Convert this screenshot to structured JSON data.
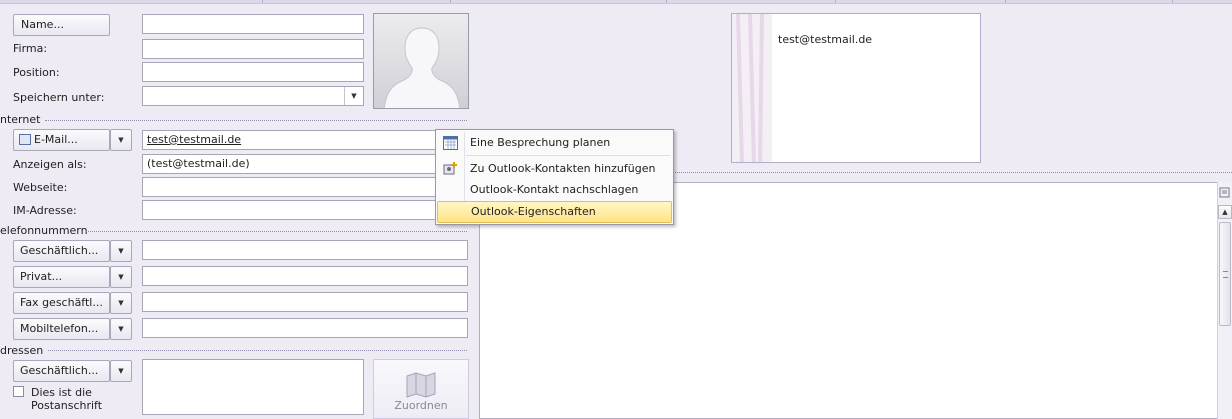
{
  "name_section": {
    "name_button": "Name...",
    "company_label": "Firma:",
    "position_label": "Position:",
    "save_as_label": "Speichern unter:"
  },
  "internet": {
    "section_title": "nternet",
    "email_button": "E-Mail...",
    "email_value": "test@testmail.de",
    "display_as_label": "Anzeigen als:",
    "display_as_value": "(test@testmail.de)",
    "webpage_label": "Webseite:",
    "im_label": "IM-Adresse:"
  },
  "phones": {
    "section_title": "elefonnummern",
    "items": [
      {
        "label": "Geschäftlich..."
      },
      {
        "label": "Privat..."
      },
      {
        "label": "Fax geschäftl..."
      },
      {
        "label": "Mobiltelefon..."
      }
    ]
  },
  "addresses": {
    "section_title": "dressen",
    "address_button": "Geschäftlich...",
    "mailing_checkbox": "Dies ist die Postanschrift",
    "map_button": "Zuordnen"
  },
  "business_card": {
    "email": "test@testmail.de"
  },
  "context_menu": {
    "items": [
      {
        "label": "Eine Besprechung planen",
        "icon": "calendar-icon"
      },
      {
        "label": "Zu Outlook-Kontakten hinzufügen",
        "icon": "add-contact-icon"
      },
      {
        "label": "Outlook-Kontakt nachschlagen",
        "icon": ""
      },
      {
        "label": "Outlook-Eigenschaften",
        "icon": ""
      }
    ]
  },
  "colors": {
    "background": "#eeebf5",
    "highlight": "#ffe485"
  }
}
